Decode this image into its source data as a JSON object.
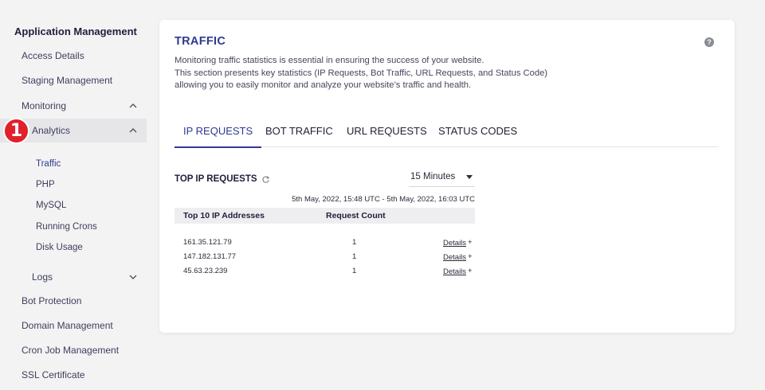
{
  "sidebar": {
    "title": "Application Management",
    "items": {
      "access_details": "Access Details",
      "staging_management": "Staging Management",
      "monitoring": "Monitoring",
      "analytics": "Analytics",
      "logs": "Logs",
      "bot_protection": "Bot Protection",
      "domain_management": "Domain Management",
      "cron_job_management": "Cron Job Management",
      "ssl_certificate": "SSL Certificate"
    },
    "analytics_sub": [
      "Traffic",
      "PHP",
      "MySQL",
      "Running Crons",
      "Disk Usage"
    ],
    "step_badge": "1"
  },
  "card": {
    "title": "TRAFFIC",
    "help": "?",
    "description": [
      "Monitoring traffic statistics is essential in ensuring the success of your website.",
      "This section presents key statistics (IP Requests, Bot Traffic, URL Requests, and Status Code)",
      "allowing you to easily monitor and analyze your website’s traffic and health."
    ],
    "tabs": [
      "IP REQUESTS",
      "BOT TRAFFIC",
      "URL REQUESTS",
      "STATUS CODES"
    ],
    "active_tab": "IP REQUESTS"
  },
  "top_ip": {
    "title": "TOP IP REQUESTS",
    "interval": "15 Minutes",
    "range": "5th May, 2022, 15:48 UTC - 5th May, 2022, 16:03 UTC",
    "headers": [
      "Top 10 IP Addresses",
      "Request Count"
    ],
    "rows": [
      {
        "ip": "161.35.121.79",
        "count": "1",
        "details": "Details",
        "plus": "+"
      },
      {
        "ip": "147.182.131.77",
        "count": "1",
        "details": "Details",
        "plus": "+"
      },
      {
        "ip": "45.63.23.239",
        "count": "1",
        "details": "Details",
        "plus": "+"
      }
    ]
  },
  "colors": {
    "accent": "#2f3a8f",
    "badge": "#e0202b",
    "active_bg": "#e6e6e9"
  }
}
